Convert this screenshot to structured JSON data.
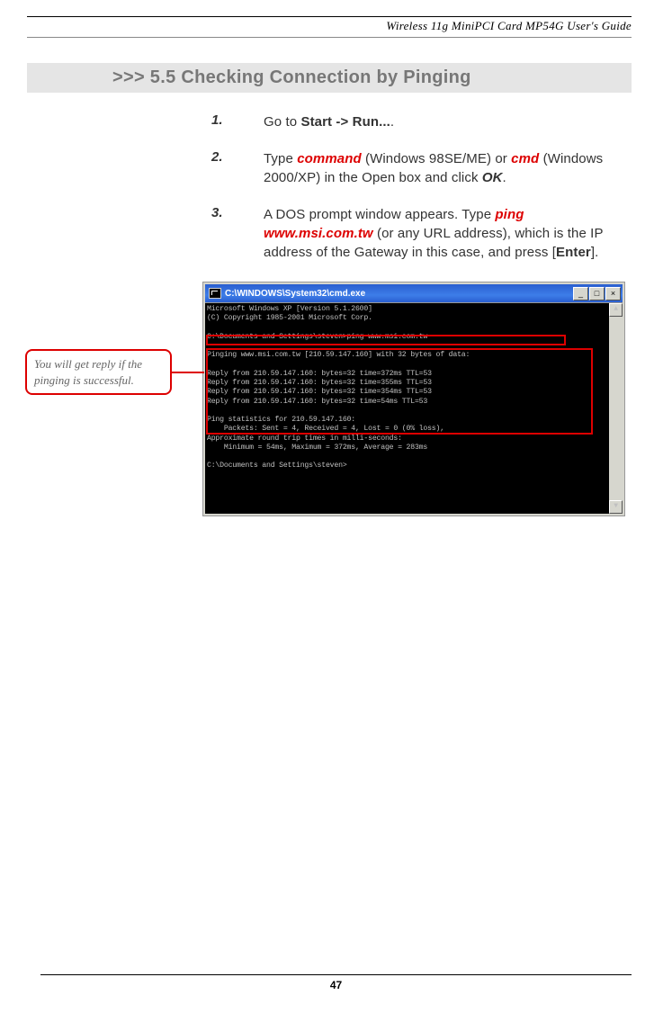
{
  "header": {
    "guide_title": "Wireless 11g MiniPCI Card MP54G User's Guide"
  },
  "section": {
    "prefix": ">>> 5.5",
    "title": "Checking Connection by Pinging"
  },
  "steps": [
    {
      "num": "1.",
      "text_before": "Go to ",
      "bold1": "Start -> Run...",
      "text_after": "."
    },
    {
      "num": "2.",
      "text1": "Type ",
      "red1": "command",
      "text2": " (Windows 98SE/ME) or ",
      "red2": "cmd",
      "text3": " (Windows 2000/XP) in the Open box and click ",
      "bolditalic1": "OK",
      "text4": "."
    },
    {
      "num": "3.",
      "text1": "A DOS prompt window appears.  Type ",
      "red1": "ping www.msi.com.tw",
      "text2": " (or any URL address), which is the IP address of the Gateway in this case, and press [",
      "bold1": "Enter",
      "text3": "]."
    }
  ],
  "callout": {
    "text": "You will get reply if the pinging is successful."
  },
  "cmd": {
    "title": "C:\\WINDOWS\\System32\\cmd.exe",
    "btn_min": "_",
    "btn_max": "□",
    "btn_close": "×",
    "sb_up": "▲",
    "sb_down": "▼",
    "lines": "Microsoft Windows XP [Version 5.1.2600]\n(C) Copyright 1985-2001 Microsoft Corp.\n\nC:\\Documents and Settings\\steven>ping www.msi.com.tw\n\nPinging www.msi.com.tw [210.59.147.160] with 32 bytes of data:\n\nReply from 210.59.147.160: bytes=32 time=372ms TTL=53\nReply from 210.59.147.160: bytes=32 time=355ms TTL=53\nReply from 210.59.147.160: bytes=32 time=354ms TTL=53\nReply from 210.59.147.160: bytes=32 time=54ms TTL=53\n\nPing statistics for 210.59.147.160:\n    Packets: Sent = 4, Received = 4, Lost = 0 (0% loss),\nApproximate round trip times in milli-seconds:\n    Minimum = 54ms, Maximum = 372ms, Average = 283ms\n\nC:\\Documents and Settings\\steven>"
  },
  "footer": {
    "page_num": "47"
  }
}
